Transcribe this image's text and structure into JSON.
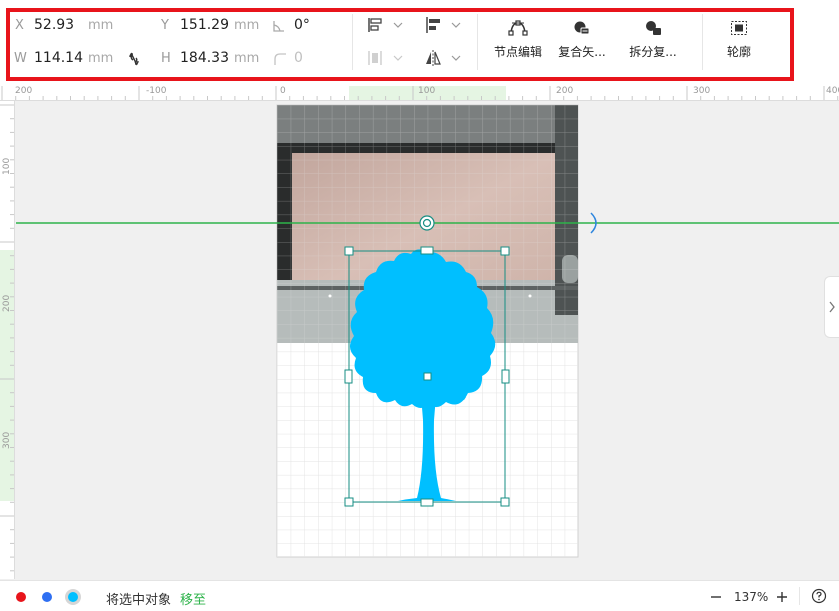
{
  "toolbar": {
    "x_label": "X",
    "x_value": "52.93",
    "x_unit": "mm",
    "y_label": "Y",
    "y_value": "151.29",
    "y_unit": "mm",
    "w_label": "W",
    "w_value": "114.14",
    "w_unit": "mm",
    "h_label": "H",
    "h_value": "184.33",
    "h_unit": "mm",
    "angle_value": "0°",
    "corner_value": "0",
    "tools": [
      {
        "label": "节点编辑",
        "icon": "node-edit-icon"
      },
      {
        "label": "复合矢...",
        "icon": "compound-vector-icon"
      },
      {
        "label": "拆分复...",
        "icon": "split-compound-icon"
      },
      {
        "label": "轮廓",
        "icon": "outline-icon"
      }
    ]
  },
  "ruler": {
    "top_labels": [
      "200",
      "-100",
      "0",
      "100",
      "200",
      "300",
      "400"
    ],
    "left_labels": [
      "100",
      "200",
      "300"
    ]
  },
  "status": {
    "colors": [
      "#e8141b",
      "#2e6ff2",
      "#00bfff"
    ],
    "move_text": "将选中对象",
    "move_link": "移至",
    "zoom": "137%"
  }
}
